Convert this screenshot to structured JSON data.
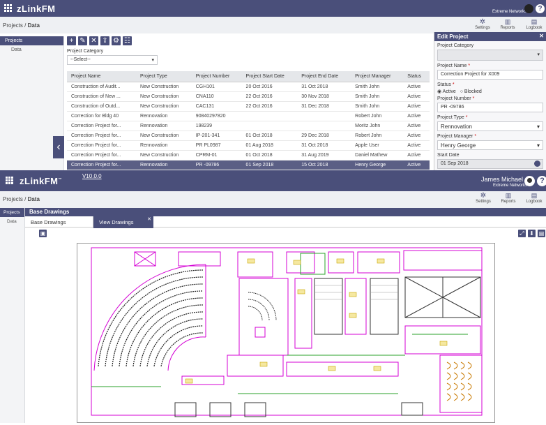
{
  "top_screen": {
    "app_name": "zLinkFM",
    "breadcrumb_root": "Projects",
    "breadcrumb_current": "Data",
    "user_org": "Extreme Networks",
    "header_links": [
      "Settings",
      "Reports",
      "Logbook"
    ],
    "sidebar": {
      "items": [
        "Projects",
        "Data"
      ]
    },
    "category_label": "Project Category",
    "category_value": "--Select--",
    "table": {
      "headers": [
        "Project Name",
        "Project Type",
        "Project Number",
        "Project Start Date",
        "Project End Date",
        "Project Manager",
        "Status"
      ],
      "rows": [
        [
          "Construction of Audit...",
          "New Construction",
          "CGH101",
          "20 Oct 2016",
          "31 Oct 2018",
          "Smith John",
          "Active"
        ],
        [
          "Construction of New ...",
          "New Construction",
          "CNA110",
          "22 Oct 2016",
          "30 Nov 2018",
          "Smith John",
          "Active"
        ],
        [
          "Construction of Outd...",
          "New Construction",
          "CAC131",
          "22 Oct 2016",
          "31 Dec 2018",
          "Smith John",
          "Active"
        ],
        [
          "Correction for Bldg 40",
          "Rennovation",
          "90840297820",
          "",
          "",
          "Robert John",
          "Active"
        ],
        [
          "Correction Project for...",
          "Rennovation",
          "198239",
          "",
          "",
          "Moritz John",
          "Active"
        ],
        [
          "Correction Project for...",
          "New Construction",
          "IP-201-341",
          "01 Oct 2018",
          "29 Dec 2018",
          "Robert John",
          "Active"
        ],
        [
          "Correction Project for...",
          "Rennovation",
          "PR PL0987",
          "01 Aug 2018",
          "31 Oct 2018",
          "Apple User",
          "Active"
        ],
        [
          "Correction Project for...",
          "New Construction",
          "CPRM-01",
          "01 Oct 2018",
          "31 Aug 2019",
          "Daniel Mathew",
          "Active"
        ],
        [
          "Correction Project for...",
          "Rennovation",
          "PR -09786",
          "01 Sep 2018",
          "15 Oct 2018",
          "Henry George",
          "Active"
        ]
      ]
    },
    "edit_panel": {
      "title": "Edit Project",
      "category_label": "Project Category",
      "name_label": "Project Name",
      "name_value": "Correction Project for X009",
      "status_label": "Status",
      "status_active": "Active",
      "status_blocked": "Blocked",
      "number_label": "Project Number",
      "number_value": "PR -09786",
      "type_label": "Project Type",
      "type_value": "Rennovation",
      "manager_label": "Project Manager",
      "manager_value": "Henry George",
      "start_label": "Start Date",
      "start_value": "01 Sep 2018"
    }
  },
  "bottom_screen": {
    "app_name": "zLinkFM",
    "version": "V10.0.0",
    "user_name": "James Michael",
    "user_org": "Extreme Networks",
    "breadcrumb_root": "Projects",
    "breadcrumb_current": "Data",
    "header_links": [
      "Settings",
      "Reports",
      "Logbook"
    ],
    "sidebar": {
      "items": [
        "Projects",
        "Data"
      ]
    },
    "panel_title": "Base Drawings",
    "tabs": [
      "Base Drawings",
      "View Drawings"
    ]
  },
  "colors": {
    "accent": "#4a4f7a",
    "drawing_magenta": "#d400d4",
    "drawing_green": "#2aa02a",
    "drawing_yellow": "#e0c000"
  }
}
